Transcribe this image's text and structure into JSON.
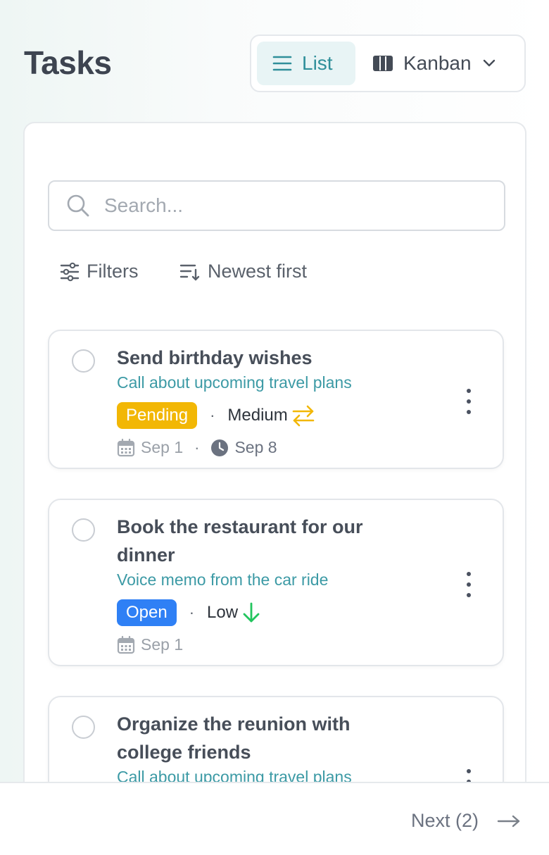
{
  "header": {
    "title": "Tasks"
  },
  "view_toggle": {
    "list_label": "List",
    "kanban_label": "Kanban",
    "active": "List"
  },
  "search": {
    "placeholder": "Search...",
    "value": ""
  },
  "toolbar": {
    "filters_label": "Filters",
    "sort_label": "Newest first"
  },
  "tasks": [
    {
      "title": "Send birthday wishes",
      "subtitle": "Call about upcoming travel plans",
      "status": "Pending",
      "priority": "Medium",
      "start_date": "Sep 1",
      "due_date": "Sep 8"
    },
    {
      "title": "Book the restaurant for our dinner",
      "subtitle": "Voice memo from the car ride",
      "status": "Open",
      "priority": "Low",
      "start_date": "Sep 1",
      "due_date": ""
    },
    {
      "title": "Organize the reunion with college friends",
      "subtitle": "Call about upcoming travel plans",
      "status": "",
      "priority": "",
      "start_date": "",
      "due_date": ""
    }
  ],
  "pagination": {
    "next_label": "Next (2)"
  },
  "colors": {
    "accent": "#2f8f9a",
    "subtitle": "#3c9aa5",
    "pending": "#f2b705",
    "open": "#2f80f5",
    "priority_medium": "#f2b705",
    "priority_low": "#22c55e"
  },
  "icons": {
    "list": "list-icon",
    "kanban": "kanban-icon",
    "chevron": "chevron-down-icon",
    "search": "search-icon",
    "filters": "sliders-icon",
    "sort": "sort-descending-icon",
    "start": "calendar-icon",
    "due": "clock-icon",
    "menu": "kebab-menu-icon",
    "next": "arrow-right-icon",
    "priority_medium": "swap-arrows-icon",
    "priority_low": "arrow-down-icon"
  }
}
